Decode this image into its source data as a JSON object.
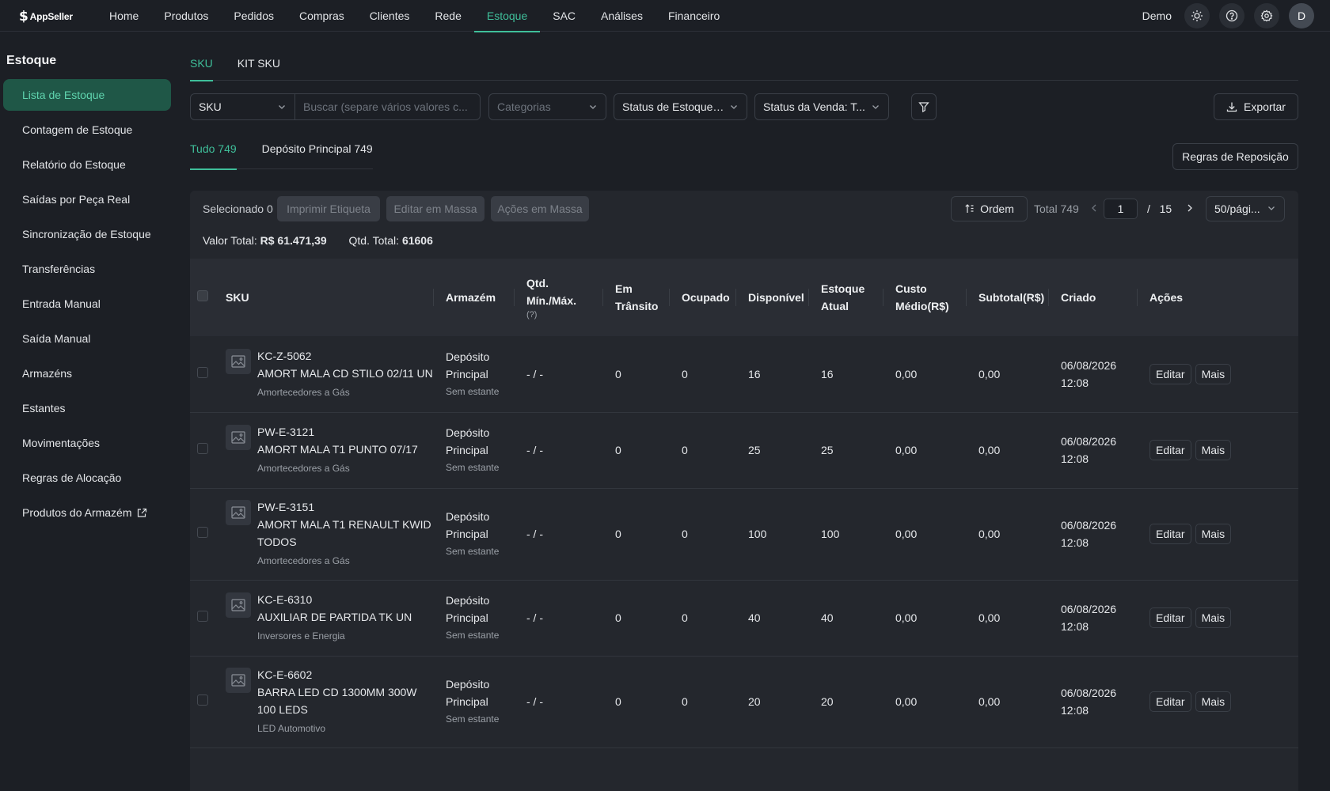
{
  "brand": {
    "name": "AppSeller"
  },
  "nav": {
    "items": [
      "Home",
      "Produtos",
      "Pedidos",
      "Compras",
      "Clientes",
      "Rede",
      "Estoque",
      "SAC",
      "Análises",
      "Financeiro"
    ],
    "active": "Estoque"
  },
  "user": {
    "name": "Demo",
    "initial": "D"
  },
  "sidebar": {
    "title": "Estoque",
    "items": [
      "Lista de Estoque",
      "Contagem de Estoque",
      "Relatório do Estoque",
      "Saídas por Peça Real",
      "Sincronização de Estoque",
      "Transferências",
      "Entrada Manual",
      "Saída Manual",
      "Armazéns",
      "Estantes",
      "Movimentações",
      "Regras de Alocação",
      "Produtos do Armazém"
    ],
    "active_index": 0
  },
  "tabs": [
    "SKU",
    "KIT SKU"
  ],
  "filters": {
    "search_type": "SKU",
    "search_placeholder": "Buscar (separe vários valores c...",
    "categories_placeholder": "Categorias",
    "stock_status": "Status de Estoque: ...",
    "sale_status": "Status da Venda: T...",
    "export_label": "Exportar"
  },
  "warehouse_tabs": [
    "Tudo 749",
    "Depósito Principal 749"
  ],
  "replenish_label": "Regras de Reposição",
  "toolbar": {
    "selected": "Selecionado 0",
    "print_label": "Imprimir Etiqueta",
    "bulk_edit_label": "Editar em Massa",
    "bulk_actions_label": "Ações em Massa",
    "order_label": "Ordem",
    "total_label": "Total 749",
    "page": "1",
    "page_of": "/",
    "page_count": "15",
    "per_page": "50/pági..."
  },
  "totals": {
    "value_label": "Valor Total:",
    "value": "R$ 61.471,39",
    "qty_label": "Qtd. Total:",
    "qty": "61606"
  },
  "table": {
    "headers": {
      "sku": "SKU",
      "warehouse": "Armazém",
      "minmax_1": "Qtd.",
      "minmax_2": "Mín./Máx.",
      "minmax_hint": "(?)",
      "transit_1": "Em",
      "transit_2": "Trânsito",
      "occupied": "Ocupado",
      "available": "Disponível",
      "current_1": "Estoque",
      "current_2": "Atual",
      "cost_1": "Custo",
      "cost_2": "Médio(R$)",
      "subtotal": "Subtotal(R$)",
      "created": "Criado",
      "actions": "Ações"
    },
    "edit_label": "Editar",
    "more_label": "Mais",
    "rows": [
      {
        "code": "KC-Z-5062",
        "name": "AMORT MALA CD STILO 02/11 UN",
        "category": "Amortecedores a Gás",
        "wh1": "Depósito",
        "wh2": "Principal",
        "shelf": "Sem estante",
        "minmax": "- / -",
        "transit": "0",
        "occupied": "0",
        "available": "16",
        "current": "16",
        "cost": "0,00",
        "subtotal": "0,00",
        "date": "06/08/2026",
        "time": "12:08"
      },
      {
        "code": "PW-E-3121",
        "name": "AMORT MALA T1 PUNTO 07/17",
        "category": "Amortecedores a Gás",
        "wh1": "Depósito",
        "wh2": "Principal",
        "shelf": "Sem estante",
        "minmax": "- / -",
        "transit": "0",
        "occupied": "0",
        "available": "25",
        "current": "25",
        "cost": "0,00",
        "subtotal": "0,00",
        "date": "06/08/2026",
        "time": "12:08"
      },
      {
        "code": "PW-E-3151",
        "name": "AMORT MALA T1 RENAULT KWID TODOS",
        "category": "Amortecedores a Gás",
        "wh1": "Depósito",
        "wh2": "Principal",
        "shelf": "Sem estante",
        "minmax": "- / -",
        "transit": "0",
        "occupied": "0",
        "available": "100",
        "current": "100",
        "cost": "0,00",
        "subtotal": "0,00",
        "date": "06/08/2026",
        "time": "12:08"
      },
      {
        "code": "KC-E-6310",
        "name": "AUXILIAR DE PARTIDA TK UN",
        "category": "Inversores e Energia",
        "wh1": "Depósito",
        "wh2": "Principal",
        "shelf": "Sem estante",
        "minmax": "- / -",
        "transit": "0",
        "occupied": "0",
        "available": "40",
        "current": "40",
        "cost": "0,00",
        "subtotal": "0,00",
        "date": "06/08/2026",
        "time": "12:08"
      },
      {
        "code": "KC-E-6602",
        "name": "BARRA LED CD 1300MM 300W 100 LEDS",
        "category": "LED Automotivo",
        "wh1": "Depósito",
        "wh2": "Principal",
        "shelf": "Sem estante",
        "minmax": "- / -",
        "transit": "0",
        "occupied": "0",
        "available": "20",
        "current": "20",
        "cost": "0,00",
        "subtotal": "0,00",
        "date": "06/08/2026",
        "time": "12:08"
      }
    ]
  },
  "colors": {
    "accent": "#3fbf9a",
    "active_bg": "#1f5747",
    "background": "#1c1f25",
    "panel": "#24272d"
  }
}
